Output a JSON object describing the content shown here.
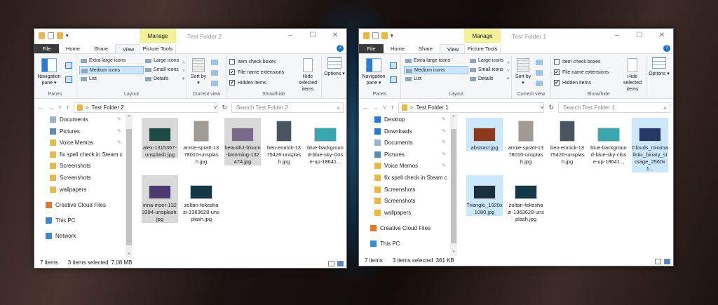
{
  "ribbon": {
    "tabs": {
      "file": "File",
      "home": "Home",
      "share": "Share",
      "view": "View"
    },
    "manage": "Manage",
    "picture_tools": "Picture Tools",
    "panes": {
      "nav_pane": "Navigation pane ▾",
      "label": "Panes"
    },
    "layout": {
      "items": [
        "Extra large icons",
        "Large icons",
        "Medium icons",
        "Small icons",
        "List",
        "Details"
      ],
      "selected": "Medium icons",
      "label": "Layout"
    },
    "current_view": {
      "sort": "Sort by ▾",
      "label": "Current view"
    },
    "show_hide": {
      "item_check_boxes": "Item check boxes",
      "file_name_extensions": "File name extensions",
      "hidden_items": "Hidden items",
      "hide_selected": "Hide selected items",
      "label": "Show/hide",
      "checked": {
        "item_check_boxes": false,
        "file_name_extensions": true,
        "hidden_items": true
      }
    },
    "options": "Options ▾"
  },
  "windows": [
    {
      "title": "Test Folder 2",
      "path": "Test Folder 2",
      "search_placeholder": "Search Test Folder 2",
      "nav": [
        {
          "label": "Documents",
          "icon": "documents-icon",
          "pinned": true
        },
        {
          "label": "Pictures",
          "icon": "pictures-icon",
          "pinned": true
        },
        {
          "label": "Voice Memos",
          "icon": "folder-icon",
          "pinned": true
        },
        {
          "label": "fix spell check in Steam ch",
          "icon": "folder-icon"
        },
        {
          "label": "Screenshots",
          "icon": "folder-icon"
        },
        {
          "label": "Screenshots",
          "icon": "folder-icon"
        },
        {
          "label": "wallpapers",
          "icon": "folder-icon"
        },
        {
          "label": "Creative Cloud Files",
          "icon": "creative-cloud-icon",
          "root": true
        },
        {
          "label": "This PC",
          "icon": "this-pc-icon",
          "root": true
        },
        {
          "label": "Network",
          "icon": "network-icon",
          "root": true
        }
      ],
      "files": [
        {
          "name": "alex-1315367-unsplash.jpg",
          "selected": true,
          "thumb": "#1e4a45"
        },
        {
          "name": "annie-spratt-1378010-unsplash.jpg",
          "thumb": "#a09a94",
          "portrait": true
        },
        {
          "name": "beautiful-bloom-blooming-132474.jpg",
          "selected": true,
          "thumb": "#7a6a8a"
        },
        {
          "name": "ben-emrick-1375426-unsplash.jpg",
          "thumb": "#4a5560",
          "portrait": true
        },
        {
          "name": "blue-background-blue-sky-close-up-18641...",
          "thumb": "#3aa6b0"
        },
        {
          "name": "irina-iriser-1323394-unsplash.jpg",
          "selected": true,
          "thumb": "#4a3a70"
        },
        {
          "name": "zoltan-fekeshazi-1363628-unsplash.jpg",
          "thumb": "#143848"
        }
      ],
      "status": {
        "items": "7 items",
        "selected": "3 items selected",
        "size": "7.08 MB"
      }
    },
    {
      "title": "Test Folder 1",
      "path": "Test Folder 1",
      "search_placeholder": "Search Test Folder 1",
      "nav": [
        {
          "label": "Desktop",
          "icon": "desktop-icon",
          "pinned": true
        },
        {
          "label": "Downloads",
          "icon": "downloads-icon",
          "pinned": true
        },
        {
          "label": "Documents",
          "icon": "documents-icon",
          "pinned": true
        },
        {
          "label": "Pictures",
          "icon": "pictures-icon",
          "pinned": true
        },
        {
          "label": "Voice Memos",
          "icon": "folder-icon",
          "pinned": true
        },
        {
          "label": "fix spell check in Steam ch",
          "icon": "folder-icon"
        },
        {
          "label": "Screenshots",
          "icon": "folder-icon"
        },
        {
          "label": "Screenshots",
          "icon": "folder-icon"
        },
        {
          "label": "wallpapers",
          "icon": "folder-icon"
        },
        {
          "label": "Creative Cloud Files",
          "icon": "creative-cloud-icon",
          "root": true
        },
        {
          "label": "This PC",
          "icon": "this-pc-icon",
          "root": true
        }
      ],
      "files": [
        {
          "name": "abstract.jpg",
          "selected": true,
          "thumb": "#8a3a1a"
        },
        {
          "name": "annie-spratt-1378010-unsplash.jpg",
          "thumb": "#a09a94",
          "portrait": true
        },
        {
          "name": "ben-emrick-1375426-unsplash.jpg",
          "thumb": "#4a5560",
          "portrait": true
        },
        {
          "name": "blue-background-blue-sky-close-up-18641...",
          "thumb": "#3aa6b0"
        },
        {
          "name": "Clouds_minimalistic_binary_storage_2560x1...",
          "selected": true,
          "thumb": "#243a66"
        },
        {
          "name": "Triangle_1920x1080.jpg",
          "selected": true,
          "thumb": "#1a3040"
        },
        {
          "name": "zoltan-fekeshazi-1363628-unsplash.jpg",
          "thumb": "#143848"
        }
      ],
      "status": {
        "items": "7 items",
        "selected": "3 items selected",
        "size": "361 KB"
      }
    }
  ]
}
